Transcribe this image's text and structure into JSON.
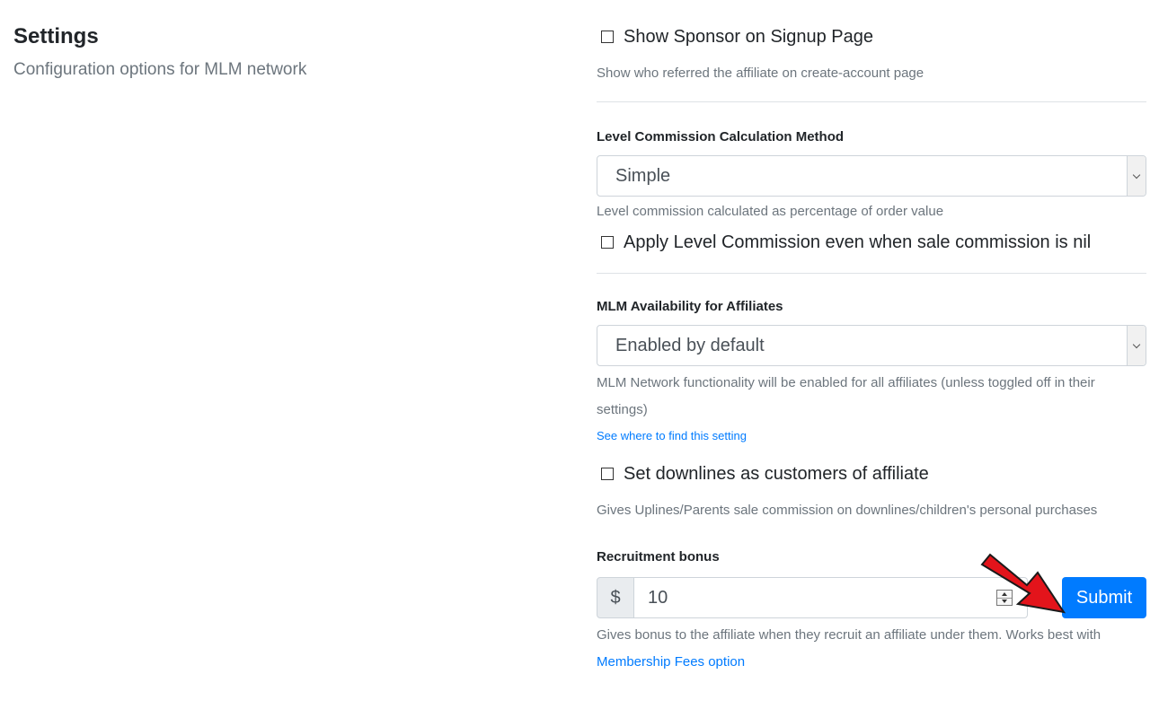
{
  "header": {
    "title": "Settings",
    "subtitle": "Configuration options for MLM network"
  },
  "settings": {
    "show_sponsor": {
      "label": "Show Sponsor on Signup Page",
      "checked": false,
      "help": "Show who referred the affiliate on create-account page"
    },
    "level_commission_method": {
      "label": "Level Commission Calculation Method",
      "selected": "Simple",
      "help": "Level commission calculated as percentage of order value"
    },
    "apply_level_commission": {
      "label": "Apply Level Commission even when sale commission is nil",
      "checked": false
    },
    "mlm_availability": {
      "label": "MLM Availability for Affiliates",
      "selected": "Enabled by default",
      "help_line1": "MLM Network functionality will be enabled for all affiliates (unless toggled off in their",
      "help_line2": "settings)",
      "link": "See where to find this setting"
    },
    "downlines_customers": {
      "label": "Set downlines as customers of affiliate",
      "checked": false,
      "help": "Gives Uplines/Parents sale commission on downlines/children's personal purchases"
    },
    "recruitment_bonus": {
      "label": "Recruitment bonus",
      "currency": "$",
      "value": "10",
      "help": "Gives bonus to the affiliate when they recruit an affiliate under them. Works best with",
      "link": "Membership Fees option"
    },
    "submit_label": "Submit"
  },
  "colors": {
    "primary": "#007bff",
    "muted": "#6c757d",
    "annotation_arrow": "#e3141b"
  },
  "icons": {
    "dropdown": "chevron-down-icon",
    "spinner": "spinner-arrows-icon",
    "annotation": "red-arrow-icon"
  }
}
